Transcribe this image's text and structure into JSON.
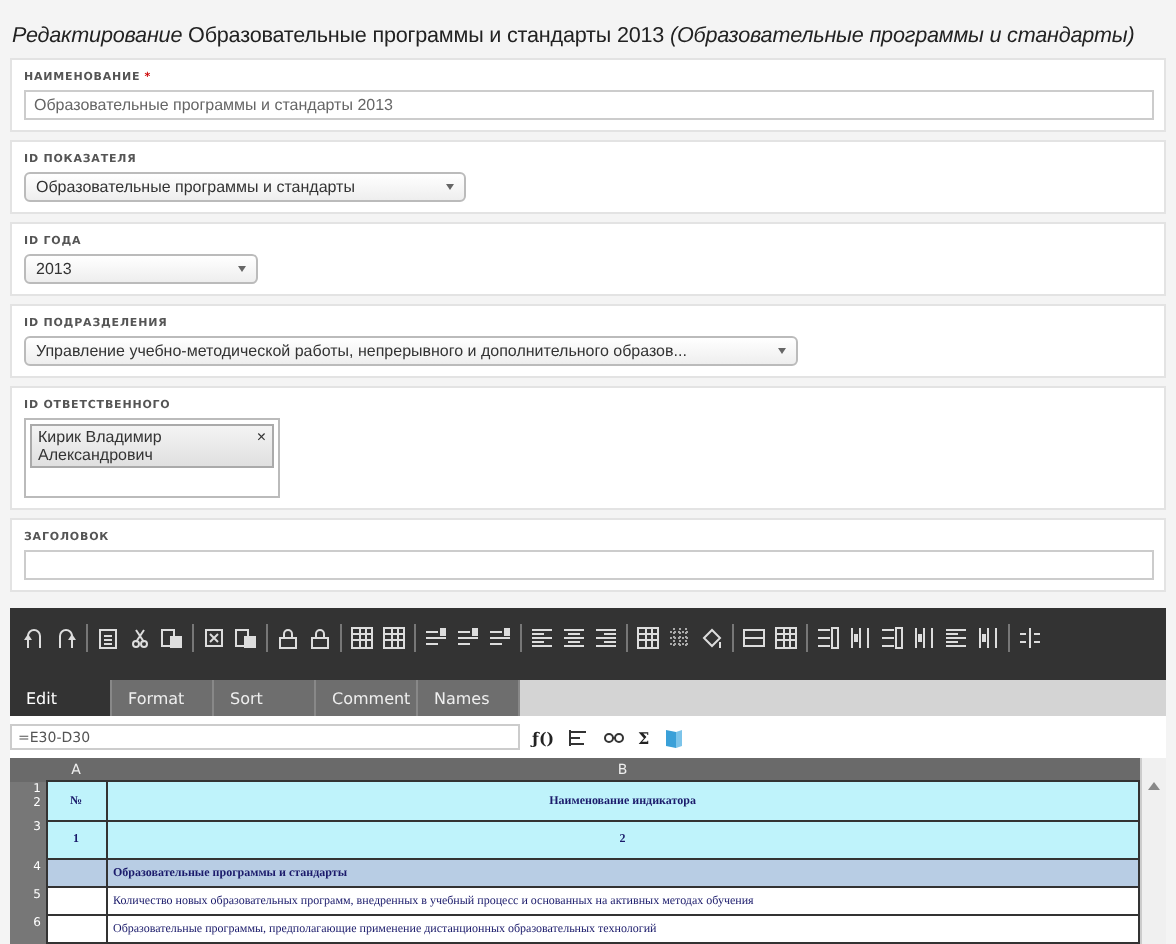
{
  "page_title": {
    "prefix": "Редактирование",
    "name": "Образовательные программы и стандарты 2013",
    "suffix": "(Образовательные программы и стандарты)"
  },
  "fields": [
    {
      "kind": "text",
      "label": "НАИМЕНОВАНИЕ",
      "required_mark": "*",
      "value": "Образовательные программы и стандарты 2013"
    },
    {
      "kind": "select",
      "label": "ID ПОКАЗАТЕЛЯ",
      "value": "Образовательные программы и стандарты"
    },
    {
      "kind": "select",
      "label": "ID ГОДА",
      "value": "2013"
    },
    {
      "kind": "select",
      "label": "ID ПОДРАЗДЕЛЕНИЯ",
      "value": "Управление учебно-методической работы, непрерывного и дополнительного образов..."
    },
    {
      "kind": "tags",
      "label": "ID ОТВЕТСТВЕННОГО",
      "tags": [
        {
          "text": "Кирик Владимир Александрович",
          "remove": "×"
        }
      ]
    },
    {
      "kind": "text",
      "label": "ЗАГОЛОВОК"
    }
  ],
  "sheet": {
    "tabs": [
      {
        "label": "Edit",
        "selected": true
      },
      {
        "label": "Format",
        "selected": false
      },
      {
        "label": "Sort",
        "selected": false
      },
      {
        "label": "Comment",
        "selected": false
      },
      {
        "label": "Names",
        "selected": false
      }
    ],
    "formula": "=E30-D30",
    "formula_buttons": [
      "ƒ()",
      "Σ"
    ],
    "columns": [
      "A",
      "B"
    ],
    "rows": [
      {
        "kind": "header",
        "numbers": [
          "1",
          "2"
        ],
        "number_cell": "№",
        "title": "Наименование индикатора"
      },
      {
        "kind": "header",
        "numbers": [
          "3"
        ],
        "number_cell": "1",
        "title": "2"
      },
      {
        "kind": "section",
        "numbers": [
          "4"
        ],
        "title": "Образовательные программы и стандарты"
      },
      {
        "kind": "item",
        "numbers": [
          "5"
        ],
        "title": "Количество новых образовательных программ, внедренных в учебный процесс и основанных на активных методах обучения"
      },
      {
        "kind": "item",
        "numbers": [
          "6"
        ],
        "title": "Образовательные программы, предполагающие применение дистанционных образовательных технологий"
      }
    ]
  }
}
